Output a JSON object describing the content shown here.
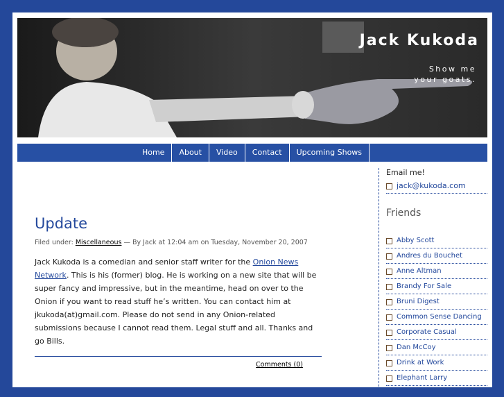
{
  "header": {
    "title": "Jack Kukoda",
    "tagline_line1": "Show me",
    "tagline_line2": "your goats."
  },
  "nav": {
    "items": [
      "Home",
      "About",
      "Video",
      "Contact",
      "Upcoming Shows"
    ]
  },
  "post": {
    "title": "Update",
    "meta_prefix": "Filed under: ",
    "category": "Miscellaneous",
    "meta_suffix": " — By Jack at 12:04 am on Tuesday, November 20, 2007",
    "body_start": "Jack Kukoda is a comedian and senior staff writer for the ",
    "body_link": "Onion News Network",
    "body_end": ". This is his (former) blog. He is working on a new site that will be super fancy and impressive, but in the meantime, head on over to the Onion if you want to read stuff he’s written. You can contact him at jkukoda(at)gmail.com. Please do not send in any Onion-related submissions because I cannot read them. Legal stuff and all. Thanks and go Bills.",
    "comments": "Comments (0)"
  },
  "sidebar": {
    "email_heading": "Email me!",
    "email": "jack@kukoda.com",
    "friends_heading": "Friends",
    "friends": [
      "Abby Scott",
      "Andres du Bouchet",
      "Anne Altman",
      "Brandy For Sale",
      "Bruni Digest",
      "Common Sense Dancing",
      "Corporate Casual",
      "Dan McCoy",
      "Drink at Work",
      "Elephant Larry"
    ]
  },
  "colors": {
    "background": "#24489a",
    "nav": "#2750a4",
    "accent": "#23489c"
  }
}
